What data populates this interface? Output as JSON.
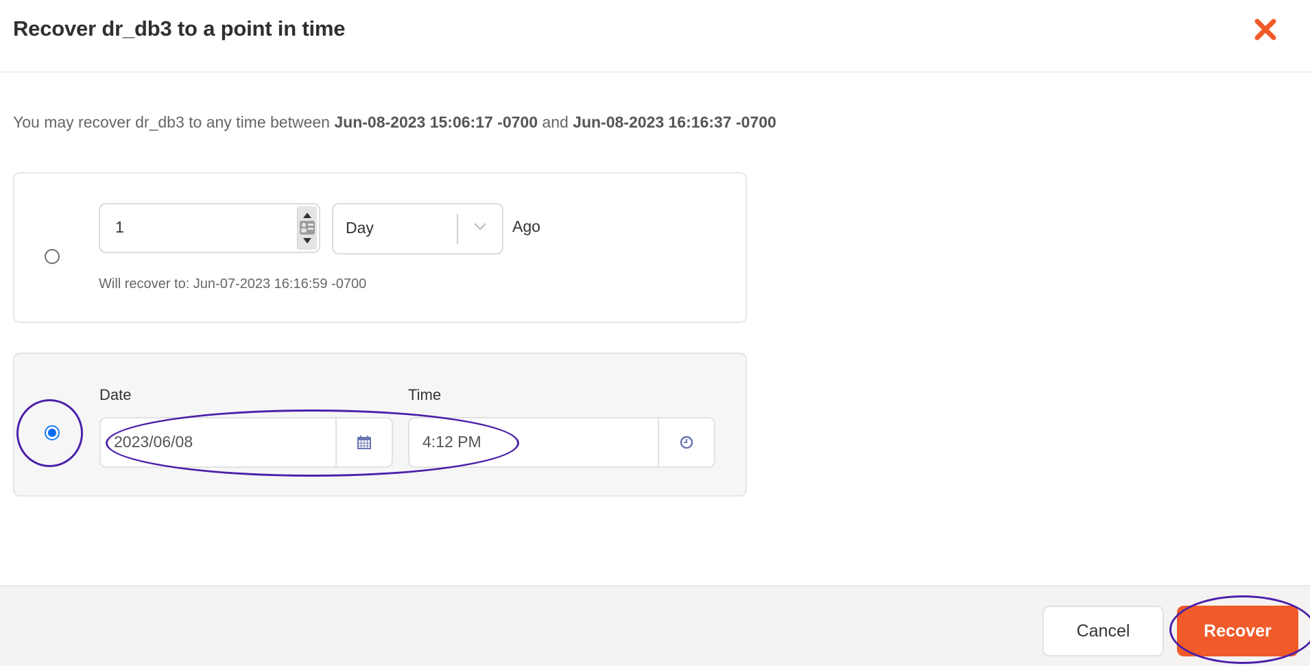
{
  "dialog": {
    "title": "Recover dr_db3 to a point in time",
    "close_icon": "close-x-icon",
    "accent_color": "#f15a29"
  },
  "description": {
    "prefix": "You may recover dr_db3 to any time between ",
    "start": "Jun-08-2023 15:06:17 -0700",
    "joiner": " and ",
    "end": "Jun-08-2023 16:16:37 -0700"
  },
  "relative_option": {
    "selected": false,
    "amount": "1",
    "unit": "Day",
    "suffix": "Ago",
    "hint": "Will recover to: Jun-07-2023 16:16:59 -0700",
    "spinner_icon": "number-spinner-icon",
    "chevron_icon": "chevron-down-icon"
  },
  "absolute_option": {
    "selected": true,
    "date_label": "Date",
    "date_value": "2023/06/08",
    "date_icon": "calendar-icon",
    "time_label": "Time",
    "time_value": "4:12 PM",
    "time_icon": "clock-icon"
  },
  "footer": {
    "cancel_label": "Cancel",
    "recover_label": "Recover"
  },
  "annotations": {
    "color": "#4b1fa9",
    "targets": [
      "absolute-radio",
      "date-time-fields",
      "recover-button"
    ]
  }
}
